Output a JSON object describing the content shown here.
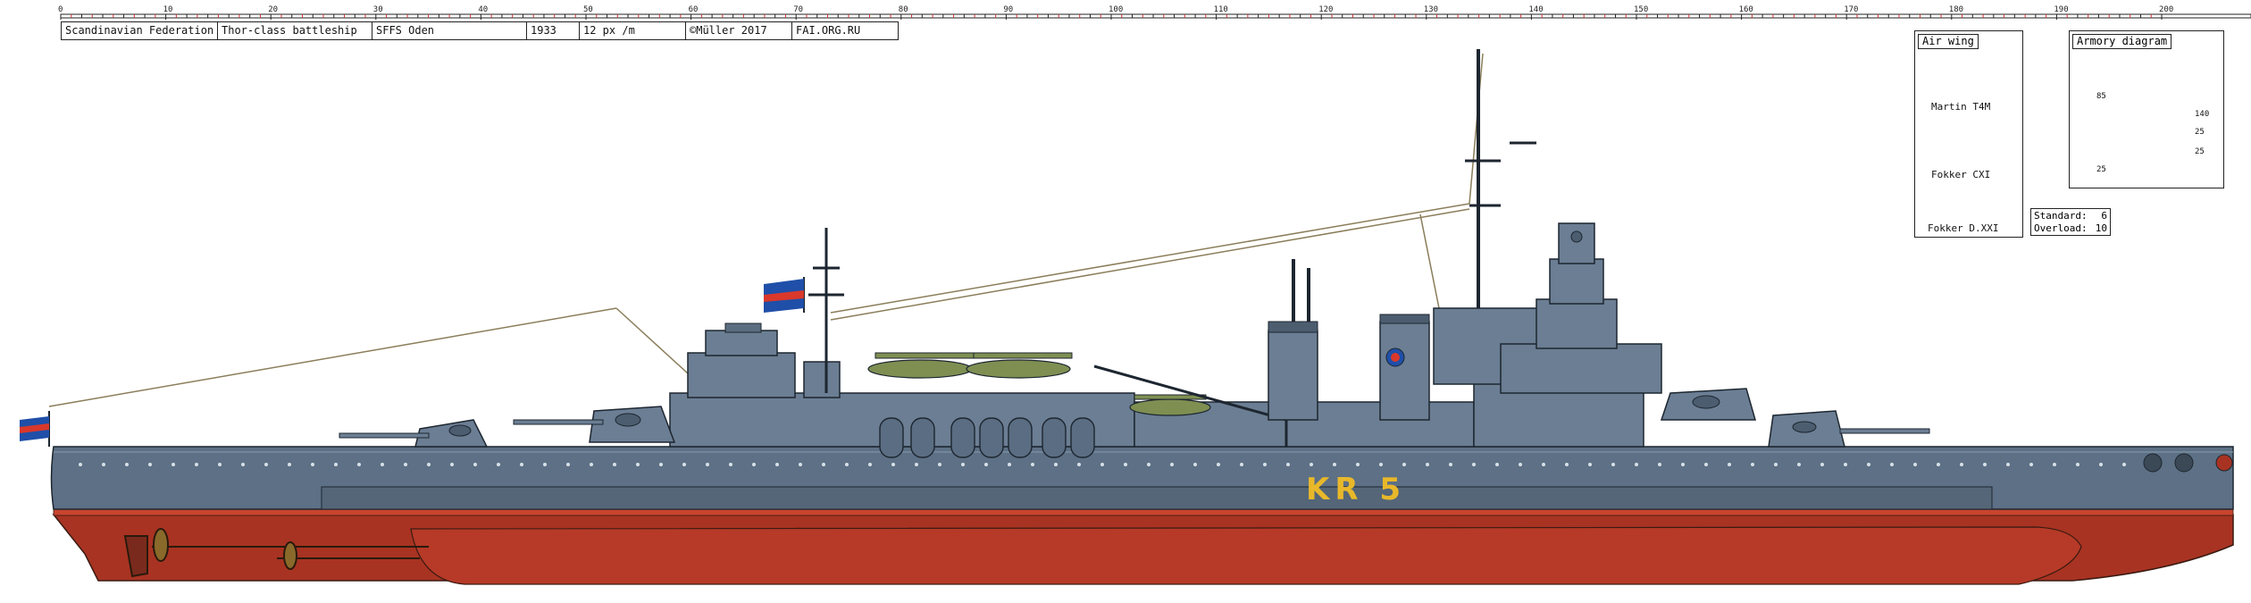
{
  "scale_ruler": {
    "labels": [
      "0",
      "10",
      "20",
      "30",
      "40",
      "50",
      "60",
      "70",
      "80",
      "90",
      "100",
      "110",
      "120",
      "130",
      "140",
      "150",
      "160",
      "170",
      "180",
      "190",
      "200"
    ]
  },
  "info_box": {
    "country": "Scandinavian  Federation",
    "ship_class": "Thor-class  battleship",
    "ship_name": "SFFS  Oden",
    "year": "1933",
    "scale": "12 px /m",
    "copyright": "©Müller  2017",
    "site": "FAI.ORG.RU"
  },
  "hull": {
    "code": "KR 5"
  },
  "air_wing": {
    "title": "Air wing",
    "aircraft": [
      "Martin T4M",
      "Fokker CXI",
      "Fokker D.XXI"
    ],
    "standard_label": "Standard:",
    "standard_value": "6",
    "overload_label": "Overload:",
    "overload_value": "10"
  },
  "armory": {
    "title": "Armory  diagram",
    "marks": [
      "85",
      "140",
      "25",
      "25",
      "25"
    ]
  },
  "colors": {
    "hull_grey": "#5d7085",
    "superstructure": "#6b7e93",
    "bottom_red": "#a83322",
    "boot_topping": "#c8452f",
    "aircraft_green": "#7f8f52",
    "hull_code_yellow": "#e8b82a"
  }
}
